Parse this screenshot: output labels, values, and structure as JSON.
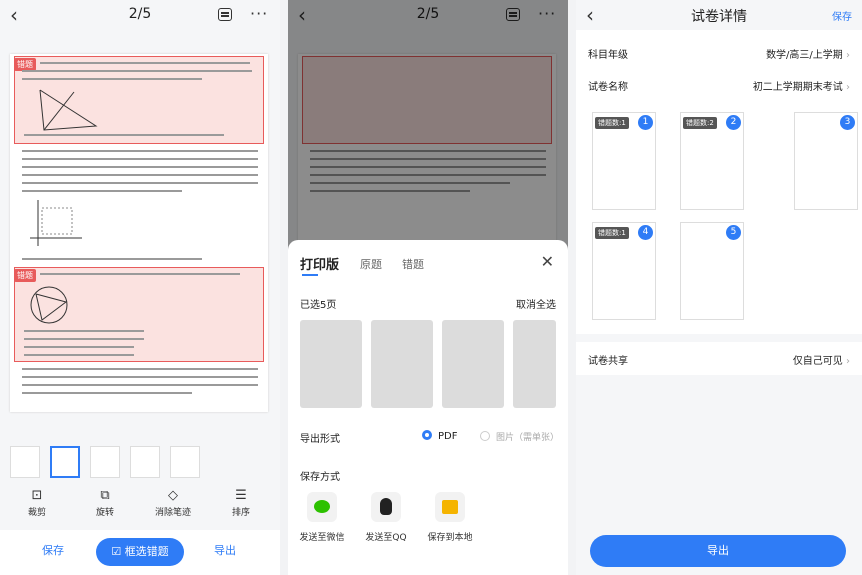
{
  "screen1": {
    "page_indicator": "2/5",
    "error_tag_1": "错题",
    "error_tag_2": "错题",
    "tools": [
      {
        "label": "裁剪",
        "icon": "crop-icon"
      },
      {
        "label": "旋转",
        "icon": "rotate-icon"
      },
      {
        "label": "消除笔迹",
        "icon": "eraser-icon"
      },
      {
        "label": "排序",
        "icon": "sort-icon"
      }
    ],
    "bottom": {
      "save": "保存",
      "select_errors": "框选错题",
      "export": "导出"
    }
  },
  "screen2": {
    "page_indicator": "2/5",
    "tabs": [
      "打印版",
      "原题",
      "错题"
    ],
    "selected_count": "已选5页",
    "deselect_all": "取消全选",
    "export_format_label": "导出形式",
    "format_pdf": "PDF",
    "format_image": "图片（需单张）",
    "save_method_label": "保存方式",
    "share_options": [
      "发送至微信",
      "发送至QQ",
      "保存到本地"
    ]
  },
  "screen3": {
    "title": "试卷详情",
    "save": "保存",
    "subject_grade_label": "科目年级",
    "subject_grade_value": "数学/高三/上学期",
    "paper_name_label": "试卷名称",
    "paper_name_value": "初二上学期期末考试",
    "pages": [
      {
        "num": "1",
        "tag": "错题数:1"
      },
      {
        "num": "2",
        "tag": "错题数:2"
      },
      {
        "num": "3",
        "tag": ""
      },
      {
        "num": "4",
        "tag": "错题数:1"
      },
      {
        "num": "5",
        "tag": ""
      }
    ],
    "share_label": "试卷共享",
    "share_value": "仅自己可见",
    "export_button": "导出"
  }
}
